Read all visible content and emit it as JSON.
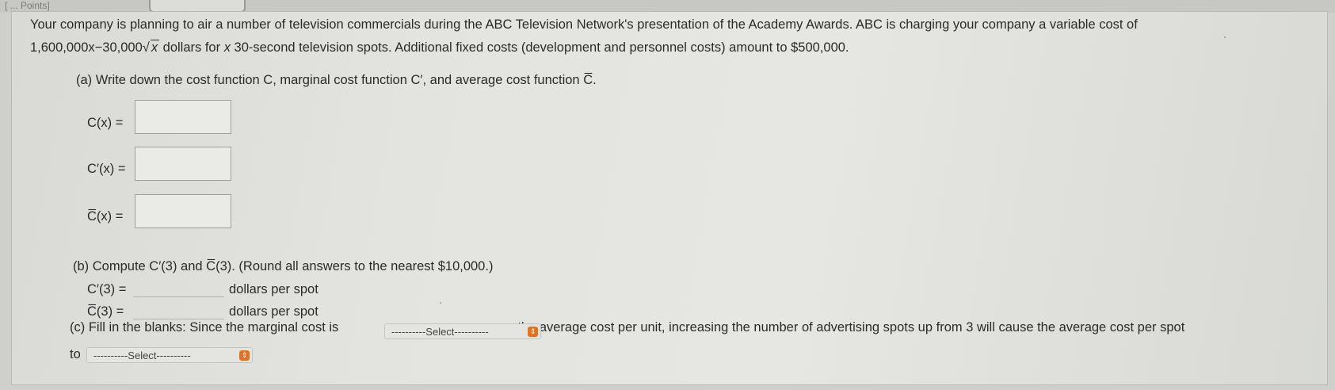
{
  "top": {
    "left_text": "[ ... Points]"
  },
  "intro": {
    "line1": "Your company is planning to air a number of television commercials during the ABC Television Network's presentation of the Academy Awards. ABC is charging your company a variable cost of",
    "line2_pre": "1,600,000x−30,000",
    "line2_sqrt_var": "x",
    "line2_post": " dollars for ",
    "line2_var": "x",
    "line2_end": " 30-second television spots. Additional fixed costs (development and personnel costs) amount to $500,000."
  },
  "part_a": {
    "prompt": "(a) Write down the cost function C, marginal cost function C′, and average cost function C̅.",
    "label_c": "C(x)  =",
    "label_cp": "C′(x)  =",
    "label_cbar": "C̅(x)  =",
    "value_c": "",
    "value_cp": "",
    "value_cbar": ""
  },
  "part_b": {
    "prompt": "(b) Compute  C′(3)  and  C̅(3).  (Round all answers to the nearest $10,000.)",
    "label_cp3": "C′(3)  =",
    "label_cbar3": "C̅(3)  =",
    "value_cp3": "",
    "value_cbar3": "",
    "unit": "dollars per spot"
  },
  "part_c": {
    "text_before": "(c) Fill in the blanks: Since the marginal cost is",
    "text_after": "the average cost per unit, increasing the number of advertising spots up from 3 will cause the average cost per spot",
    "text_to": "to",
    "select1_value": "----------Select----------",
    "select2_value": "----------Select----------"
  },
  "colors": {
    "select_arrow": "#d9742b",
    "panel_bg": "#e4e4e0"
  }
}
